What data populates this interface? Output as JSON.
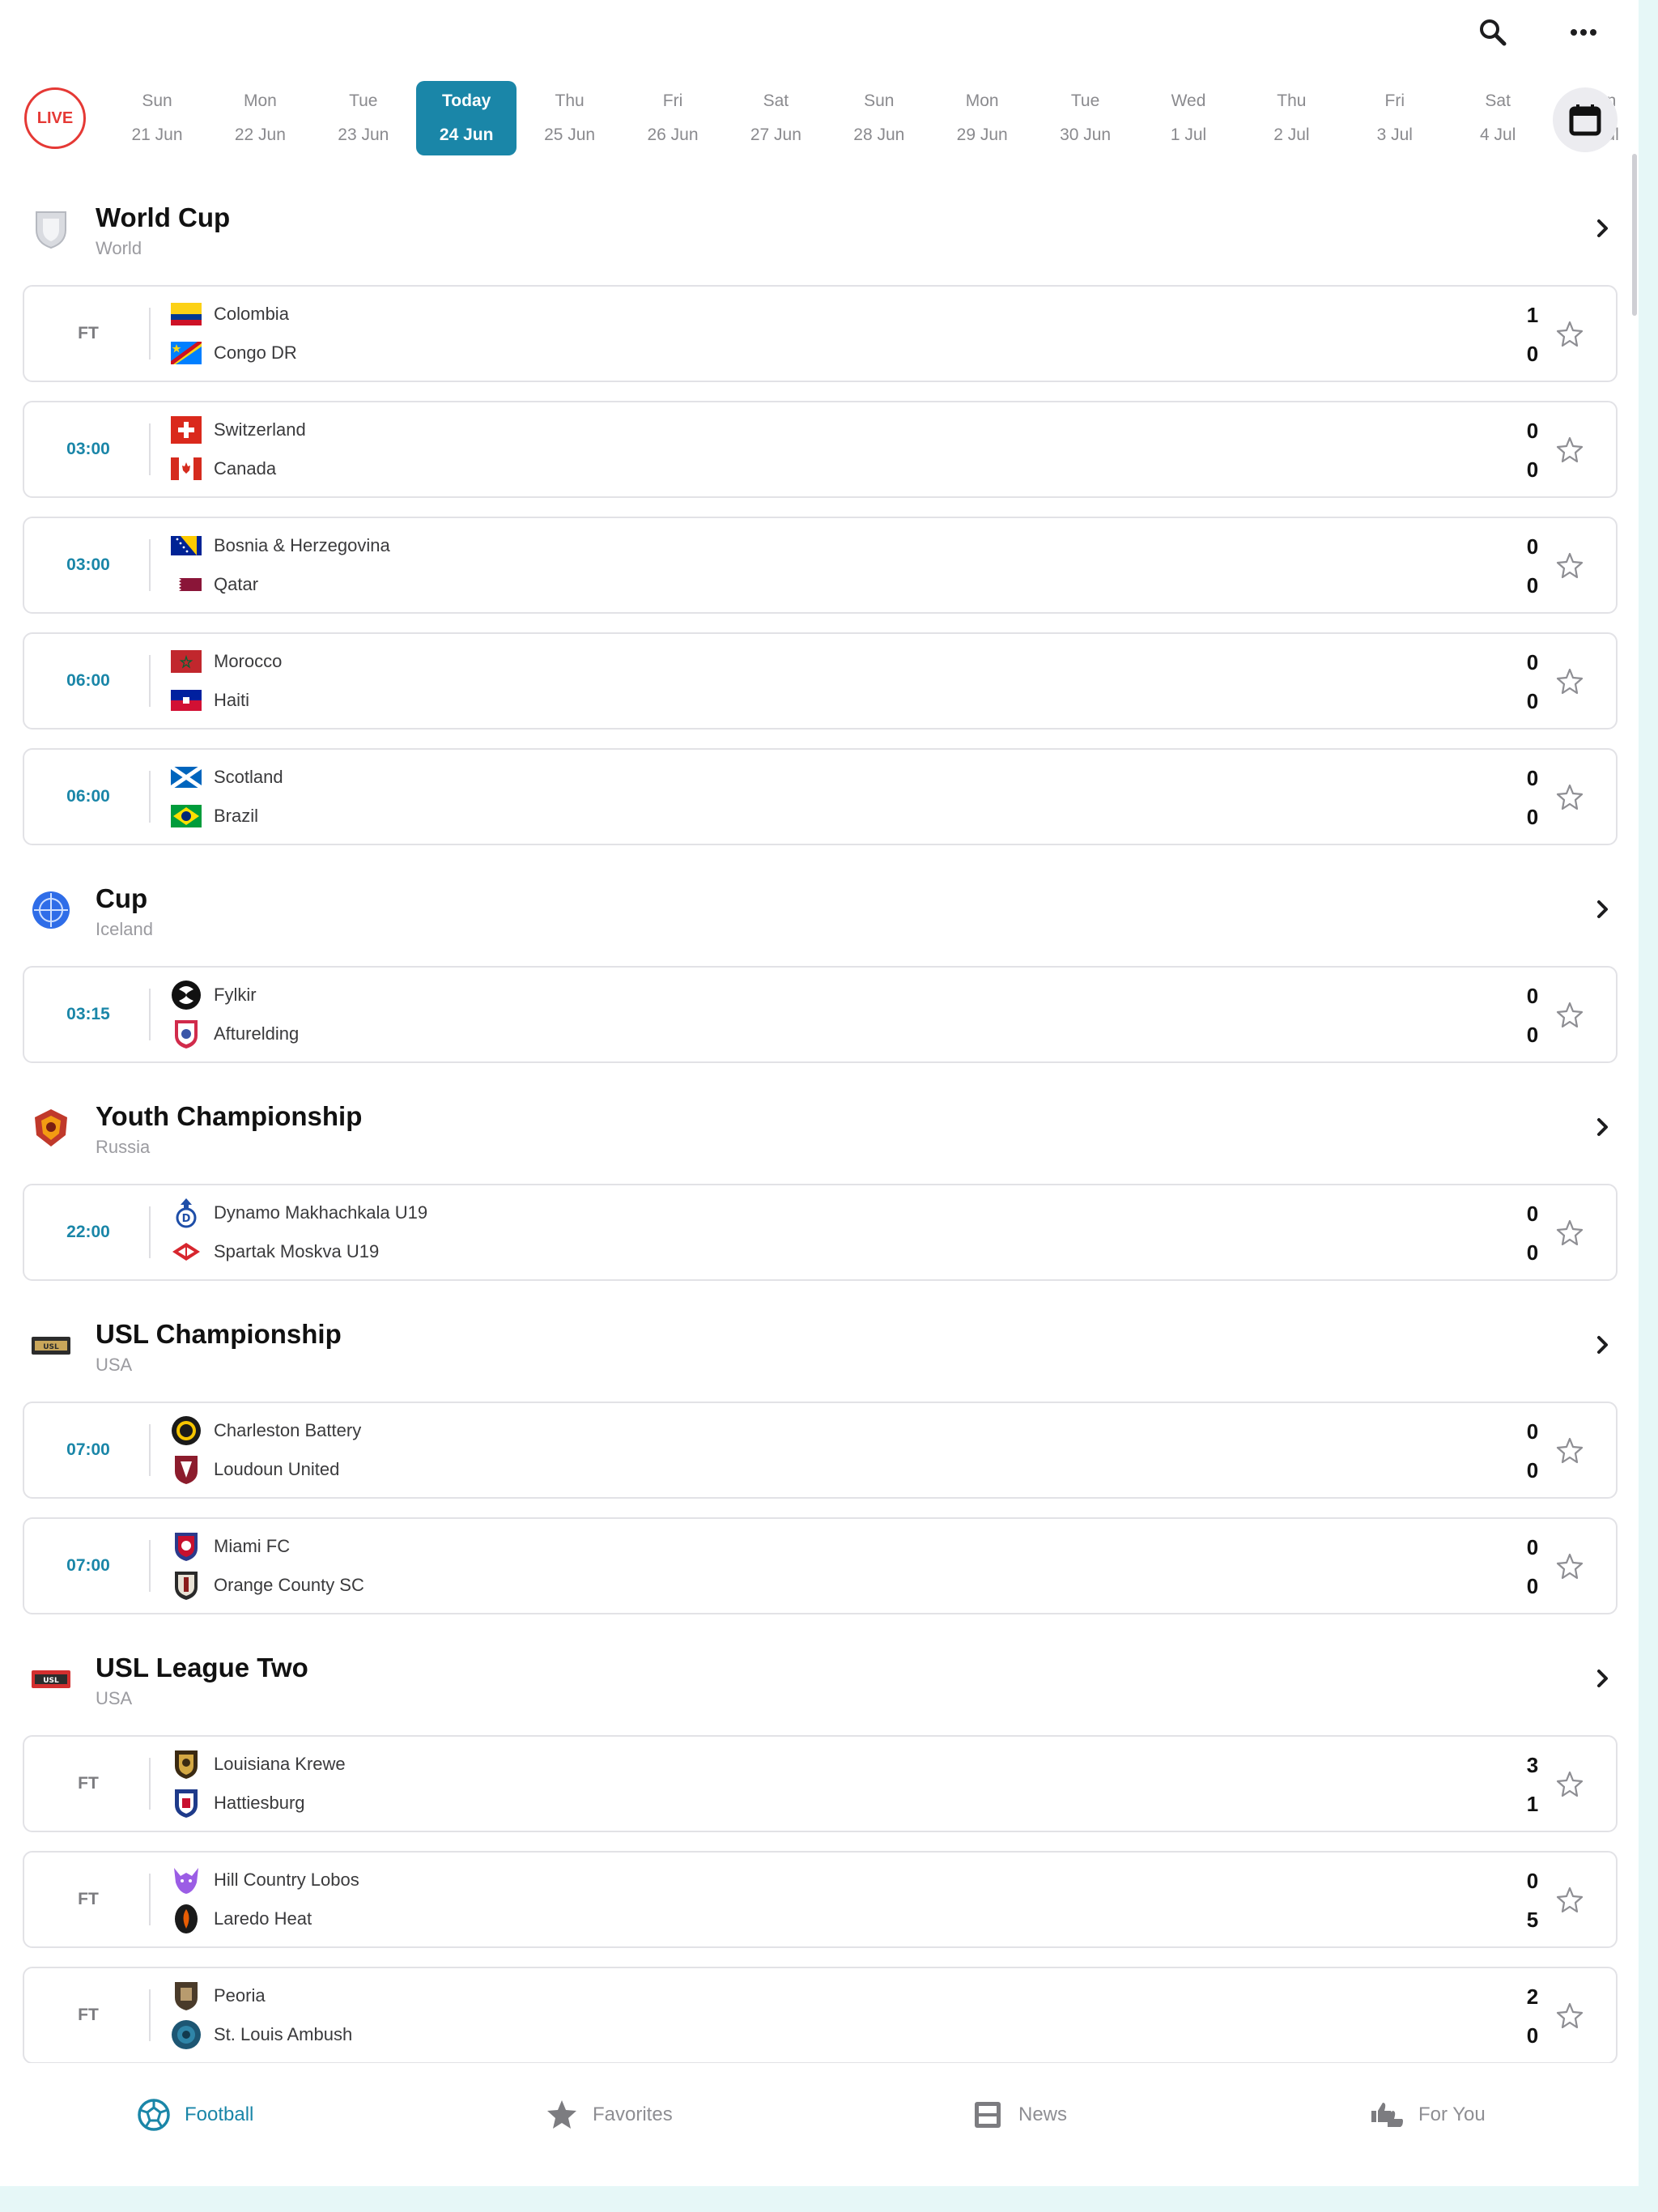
{
  "topbar": {
    "search_icon": "search-icon",
    "more_icon": "more-dots-icon"
  },
  "datestrip": {
    "live_label": "LIVE",
    "dates": [
      {
        "day": "Sun",
        "date": "21 Jun"
      },
      {
        "day": "Mon",
        "date": "22 Jun"
      },
      {
        "day": "Tue",
        "date": "23 Jun"
      },
      {
        "day": "Today",
        "date": "24 Jun",
        "selected": true
      },
      {
        "day": "Thu",
        "date": "25 Jun"
      },
      {
        "day": "Fri",
        "date": "26 Jun"
      },
      {
        "day": "Sat",
        "date": "27 Jun"
      },
      {
        "day": "Sun",
        "date": "28 Jun"
      },
      {
        "day": "Mon",
        "date": "29 Jun"
      },
      {
        "day": "Tue",
        "date": "30 Jun"
      },
      {
        "day": "Wed",
        "date": "1 Jul"
      },
      {
        "day": "Thu",
        "date": "2 Jul"
      },
      {
        "day": "Fri",
        "date": "3 Jul"
      },
      {
        "day": "Sat",
        "date": "4 Jul"
      },
      {
        "day": "Sun",
        "date": "5 Jul"
      }
    ],
    "calendar_icon": "calendar-icon"
  },
  "leagues": [
    {
      "name": "World Cup",
      "country": "World",
      "logo": "world-cup-shield-icon",
      "matches": [
        {
          "status": "FT",
          "home": "Colombia",
          "away": "Congo DR",
          "home_score": "1",
          "away_score": "0"
        },
        {
          "status": "03:00",
          "home": "Switzerland",
          "away": "Canada",
          "home_score": "0",
          "away_score": "0"
        },
        {
          "status": "03:00",
          "home": "Bosnia & Herzegovina",
          "away": "Qatar",
          "home_score": "0",
          "away_score": "0"
        },
        {
          "status": "06:00",
          "home": "Morocco",
          "away": "Haiti",
          "home_score": "0",
          "away_score": "0"
        },
        {
          "status": "06:00",
          "home": "Scotland",
          "away": "Brazil",
          "home_score": "0",
          "away_score": "0"
        }
      ]
    },
    {
      "name": "Cup",
      "country": "Iceland",
      "logo": "iceland-cup-icon",
      "matches": [
        {
          "status": "03:15",
          "home": "Fylkir",
          "away": "Afturelding",
          "home_score": "0",
          "away_score": "0"
        }
      ]
    },
    {
      "name": "Youth Championship",
      "country": "Russia",
      "logo": "russia-youth-crest-icon",
      "matches": [
        {
          "status": "22:00",
          "home": "Dynamo Makhachkala U19",
          "away": "Spartak Moskva U19",
          "home_score": "0",
          "away_score": "0"
        }
      ]
    },
    {
      "name": "USL Championship",
      "country": "USA",
      "logo": "usl-championship-logo-icon",
      "matches": [
        {
          "status": "07:00",
          "home": "Charleston Battery",
          "away": "Loudoun United",
          "home_score": "0",
          "away_score": "0"
        },
        {
          "status": "07:00",
          "home": "Miami FC",
          "away": "Orange County SC",
          "home_score": "0",
          "away_score": "0"
        }
      ]
    },
    {
      "name": "USL League Two",
      "country": "USA",
      "logo": "usl-league-two-logo-icon",
      "matches": [
        {
          "status": "FT",
          "home": "Louisiana Krewe",
          "away": "Hattiesburg",
          "home_score": "3",
          "away_score": "1"
        },
        {
          "status": "FT",
          "home": "Hill Country Lobos",
          "away": "Laredo Heat",
          "home_score": "0",
          "away_score": "5"
        },
        {
          "status": "FT",
          "home": "Peoria",
          "away": "St. Louis Ambush",
          "home_score": "2",
          "away_score": "0"
        }
      ]
    }
  ],
  "bottomnav": {
    "items": [
      {
        "label": "Football",
        "icon": "football-icon",
        "active": true
      },
      {
        "label": "Favorites",
        "icon": "star-icon"
      },
      {
        "label": "News",
        "icon": "news-icon"
      },
      {
        "label": "For You",
        "icon": "thumbs-icon"
      }
    ]
  },
  "colors": {
    "accent": "#1a86a8",
    "live": "#e53935",
    "text": "#1d1d1f",
    "muted": "#9b9ba0",
    "border": "#e2e2e6",
    "frame": "#e6f7f7"
  }
}
